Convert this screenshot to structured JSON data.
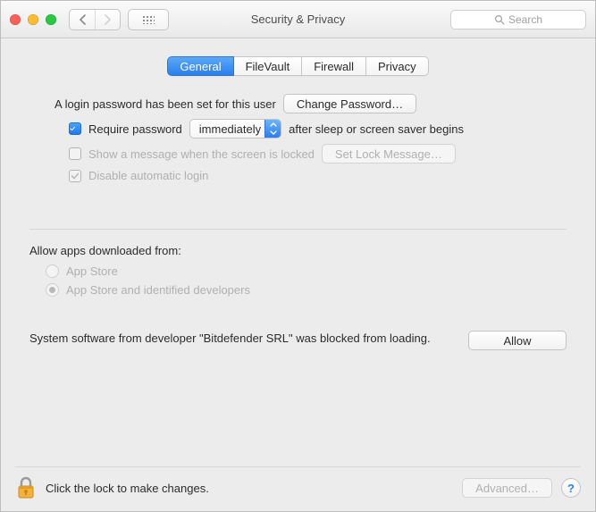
{
  "window": {
    "title": "Security & Privacy"
  },
  "toolbar": {
    "search_placeholder": "Search"
  },
  "tabs": {
    "general": "General",
    "filevault": "FileVault",
    "firewall": "Firewall",
    "privacy": "Privacy",
    "selected": "General"
  },
  "login": {
    "password_set_text": "A login password has been set for this user",
    "change_password_label": "Change Password…",
    "require_password_checked": true,
    "require_password_pre": "Require password",
    "require_password_delay": "immediately",
    "require_password_post": "after sleep or screen saver begins",
    "show_message_checked": false,
    "show_message_label": "Show a message when the screen is locked",
    "set_lock_message_label": "Set Lock Message…",
    "disable_auto_login_checked": true,
    "disable_auto_login_label": "Disable automatic login"
  },
  "gatekeeper": {
    "title": "Allow apps downloaded from:",
    "option_appstore": "App Store",
    "option_identified": "App Store and identified developers",
    "selected": "identified"
  },
  "kext": {
    "message": "System software from developer \"Bitdefender SRL\" was blocked from loading.",
    "allow_label": "Allow"
  },
  "footer": {
    "lock_text": "Click the lock to make changes.",
    "advanced_label": "Advanced…",
    "help_label": "?"
  }
}
